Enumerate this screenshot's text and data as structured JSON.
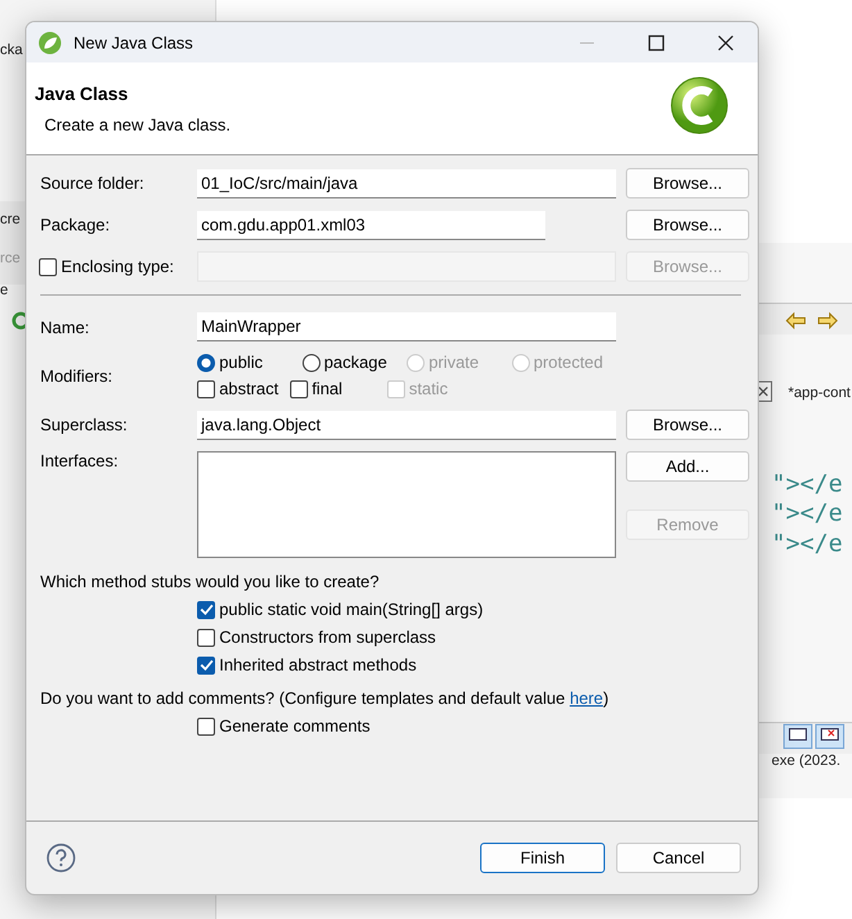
{
  "background": {
    "texts": [
      {
        "kind": "label",
        "text": "cka"
      },
      {
        "kind": "tab",
        "text": "cre"
      },
      {
        "kind": "dim",
        "text": "rce"
      },
      {
        "kind": "label",
        "text": "e"
      },
      {
        "kind": "editor-tab",
        "text": "*app-cont"
      },
      {
        "kind": "code",
        "text": "\"></e"
      },
      {
        "kind": "code",
        "text": "\"></e"
      },
      {
        "kind": "code",
        "text": "\"></e"
      },
      {
        "kind": "label",
        "text": "exe  (2023."
      }
    ]
  },
  "window": {
    "title": "New Java Class"
  },
  "header": {
    "title": "Java Class",
    "description": "Create a new Java class."
  },
  "type_fields": [
    {
      "kind": "text",
      "label": "Source folder:",
      "value": "01_IoC/src/main/java",
      "button": {
        "label": "Browse...",
        "disabled": false
      }
    },
    {
      "kind": "text-narrow",
      "label": "Package:",
      "value": "com.gdu.app01.xml03",
      "button": {
        "label": "Browse...",
        "disabled": false
      }
    },
    {
      "kind": "checkbox",
      "label": "Enclosing type:",
      "checked": false,
      "button": {
        "label": "Browse...",
        "disabled": true
      }
    }
  ],
  "name": {
    "label": "Name:",
    "value": "MainWrapper"
  },
  "modifiers": {
    "label": "Modifiers:",
    "access": [
      {
        "label": "public",
        "selected": true,
        "disabled": false
      },
      {
        "label": "package",
        "selected": false,
        "disabled": false
      },
      {
        "label": "private",
        "selected": false,
        "disabled": true
      },
      {
        "label": "protected",
        "selected": false,
        "disabled": true
      }
    ],
    "flags": [
      {
        "label": "abstract",
        "checked": false,
        "disabled": false
      },
      {
        "label": "final",
        "checked": false,
        "disabled": false
      },
      {
        "label": "static",
        "checked": false,
        "disabled": true
      }
    ]
  },
  "superclass": {
    "label": "Superclass:",
    "value": "java.lang.Object",
    "button": {
      "label": "Browse...",
      "disabled": false
    }
  },
  "interfaces": {
    "label": "Interfaces:",
    "buttons": [
      {
        "label": "Add...",
        "disabled": false
      },
      {
        "label": "Remove",
        "disabled": true
      }
    ]
  },
  "stubs": {
    "question": "Which method stubs would you like to create?",
    "options": [
      {
        "label": "public static void main(String[] args)",
        "checked": true
      },
      {
        "label": "Constructors from superclass",
        "checked": false
      },
      {
        "label": "Inherited abstract methods",
        "checked": true
      }
    ]
  },
  "comments": {
    "question_before": "Do you want to add comments? (Configure templates and default value ",
    "link": "here",
    "question_after": ")",
    "options": [
      {
        "label": "Generate comments",
        "checked": false
      }
    ]
  },
  "footer": {
    "buttons": [
      {
        "label": "Finish",
        "default": true
      },
      {
        "label": "Cancel",
        "default": false
      }
    ]
  }
}
